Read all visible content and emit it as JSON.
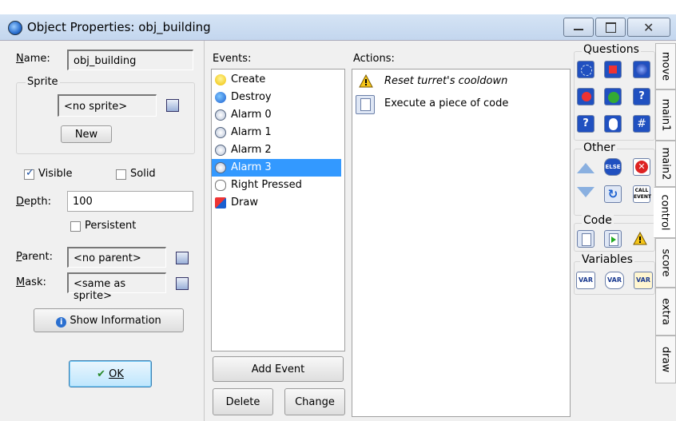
{
  "window": {
    "title": "Object Properties: obj_building",
    "minimize": "—",
    "maximize": "☐",
    "close": "✕"
  },
  "left": {
    "name_label": "Name:",
    "name_value": "obj_building",
    "sprite_group": "Sprite",
    "sprite_value": "<no sprite>",
    "new_label": "New",
    "visible_label": "Visible",
    "solid_label": "Solid",
    "depth_label": "Depth:",
    "depth_value": "100",
    "persistent_label": "Persistent",
    "parent_label": "Parent:",
    "parent_value": "<no parent>",
    "mask_label": "Mask:",
    "mask_value": "<same as sprite>",
    "show_info_label": "Show Information",
    "ok_label": "OK"
  },
  "events": {
    "header": "Events:",
    "items": [
      {
        "label": "Create",
        "icon": "bulb"
      },
      {
        "label": "Destroy",
        "icon": "destroy"
      },
      {
        "label": "Alarm 0",
        "icon": "clock"
      },
      {
        "label": "Alarm 1",
        "icon": "clock"
      },
      {
        "label": "Alarm 2",
        "icon": "clock"
      },
      {
        "label": "Alarm 3",
        "icon": "clock"
      },
      {
        "label": "Right Pressed",
        "icon": "mouse"
      },
      {
        "label": "Draw",
        "icon": "draw"
      }
    ],
    "selected_index": 5,
    "add_event": "Add Event",
    "delete": "Delete",
    "change": "Change"
  },
  "actions": {
    "header": "Actions:",
    "items": [
      {
        "label": "Reset turret's cooldown",
        "icon": "warning-icon",
        "italic": true
      },
      {
        "label": "Execute a piece of code",
        "icon": "code-icon",
        "italic": false
      }
    ]
  },
  "palette": {
    "questions": "Questions",
    "other": "Other",
    "code": "Code",
    "variables": "Variables",
    "var_label": "VAR",
    "else_label": "ELSE",
    "call_label": "CALL",
    "event_label": "EVENT"
  },
  "tabs": [
    "move",
    "main1",
    "main2",
    "control",
    "score",
    "extra",
    "draw"
  ],
  "colors": {
    "selection": "#3399ff",
    "title_bar": "#c3d6ee",
    "close_hover": "#c7d6ea"
  }
}
